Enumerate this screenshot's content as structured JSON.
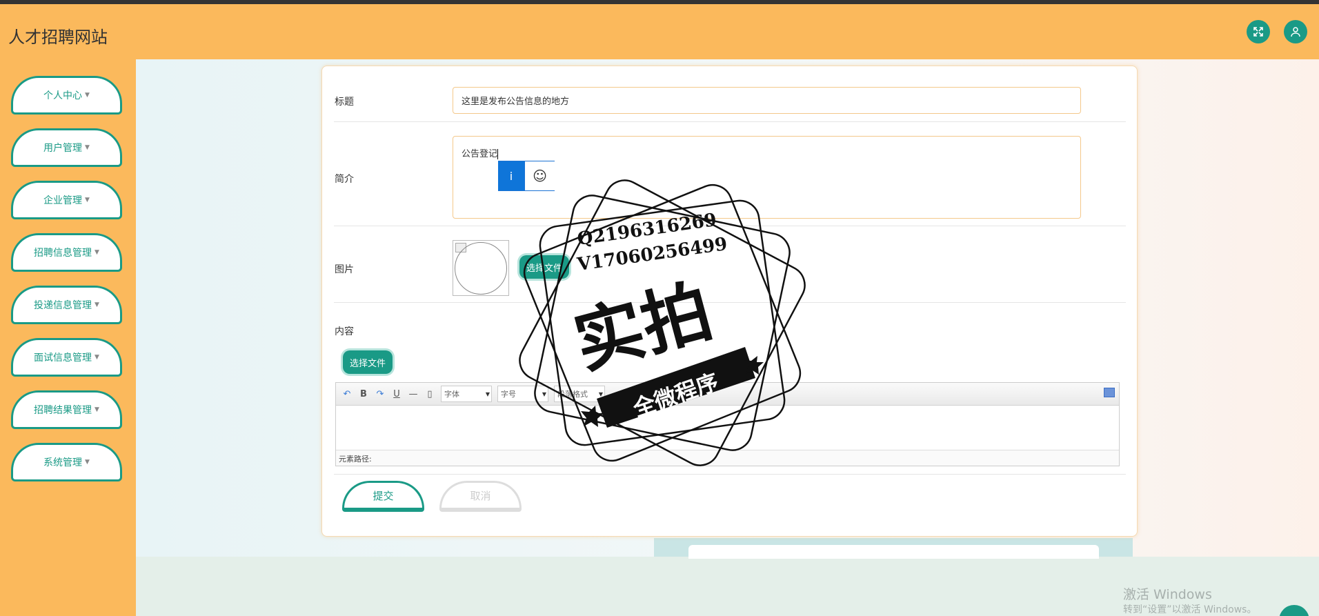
{
  "header": {
    "site_title": "人才招聘网站",
    "fullscreen_icon": "expand-icon",
    "user_icon": "user-icon"
  },
  "sidebar": {
    "items": [
      {
        "label": "个人中心"
      },
      {
        "label": "用户管理"
      },
      {
        "label": "企业管理"
      },
      {
        "label": "招聘信息管理"
      },
      {
        "label": "投递信息管理"
      },
      {
        "label": "面试信息管理"
      },
      {
        "label": "招聘结果管理"
      },
      {
        "label": "系统管理"
      }
    ]
  },
  "form": {
    "title_label": "标题",
    "title_value": "这里是发布公告信息的地方",
    "intro_label": "简介",
    "intro_value": "公告登记",
    "image_label": "图片",
    "image_choose": "选择文件",
    "content_label": "内容",
    "content_choose": "选择文件",
    "editor": {
      "font_select": "字体",
      "size_select": "字号",
      "format_select": "段落格式",
      "status": "元素路径:"
    },
    "submit": "提交",
    "cancel": "取消"
  },
  "ime": {
    "mode": "i",
    "emoji": "☺"
  },
  "watermark": {
    "line1": "Q2196316269",
    "line2": "V17060256499",
    "big": "实拍",
    "ribbon": "全微程序"
  },
  "os": {
    "activate_title": "激活 Windows",
    "activate_hint": "转到“设置”以激活 Windows。"
  }
}
